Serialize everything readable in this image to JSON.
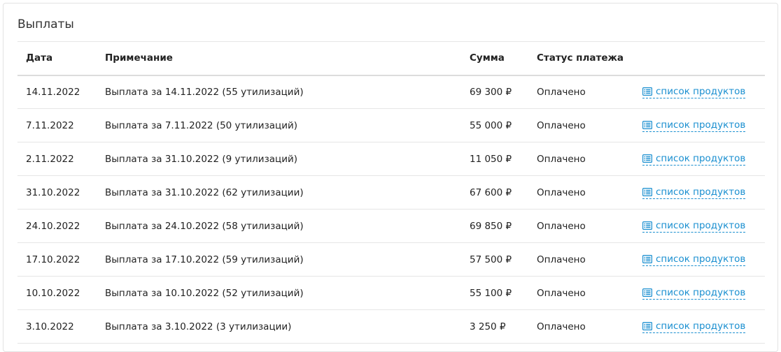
{
  "section": {
    "title": "Выплаты"
  },
  "table": {
    "headers": {
      "date": "Дата",
      "note": "Примечание",
      "amount": "Сумма",
      "status": "Статус платежа"
    },
    "link_label": "список продуктов",
    "link_icon": "list-icon",
    "rows": [
      {
        "date": "14.11.2022",
        "note": "Выплата за 14.11.2022 (55 утилизаций)",
        "amount": "69 300 ₽",
        "status": "Оплачено"
      },
      {
        "date": "7.11.2022",
        "note": "Выплата за 7.11.2022 (50 утилизаций)",
        "amount": "55 000 ₽",
        "status": "Оплачено"
      },
      {
        "date": "2.11.2022",
        "note": "Выплата за 31.10.2022 (9 утилизаций)",
        "amount": "11 050 ₽",
        "status": "Оплачено"
      },
      {
        "date": "31.10.2022",
        "note": "Выплата за 31.10.2022 (62 утилизации)",
        "amount": "67 600 ₽",
        "status": "Оплачено"
      },
      {
        "date": "24.10.2022",
        "note": "Выплата за 24.10.2022 (58 утилизаций)",
        "amount": "69 850 ₽",
        "status": "Оплачено"
      },
      {
        "date": "17.10.2022",
        "note": "Выплата за 17.10.2022 (59 утилизаций)",
        "amount": "57 500 ₽",
        "status": "Оплачено"
      },
      {
        "date": "10.10.2022",
        "note": "Выплата за 10.10.2022 (52 утилизаций)",
        "amount": "55 100 ₽",
        "status": "Оплачено"
      },
      {
        "date": "3.10.2022",
        "note": "Выплата за 3.10.2022 (3 утилизации)",
        "amount": "3 250 ₽",
        "status": "Оплачено"
      }
    ]
  },
  "colors": {
    "link": "#1a8fd0",
    "border": "#e6e6e6"
  }
}
